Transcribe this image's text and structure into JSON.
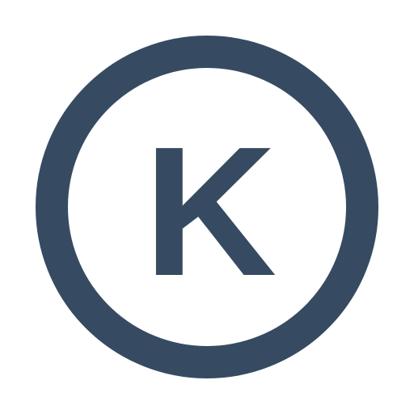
{
  "icon": {
    "name": "k-circle-icon",
    "letter": "K",
    "color": "#364b62",
    "background": "#ffffff"
  }
}
